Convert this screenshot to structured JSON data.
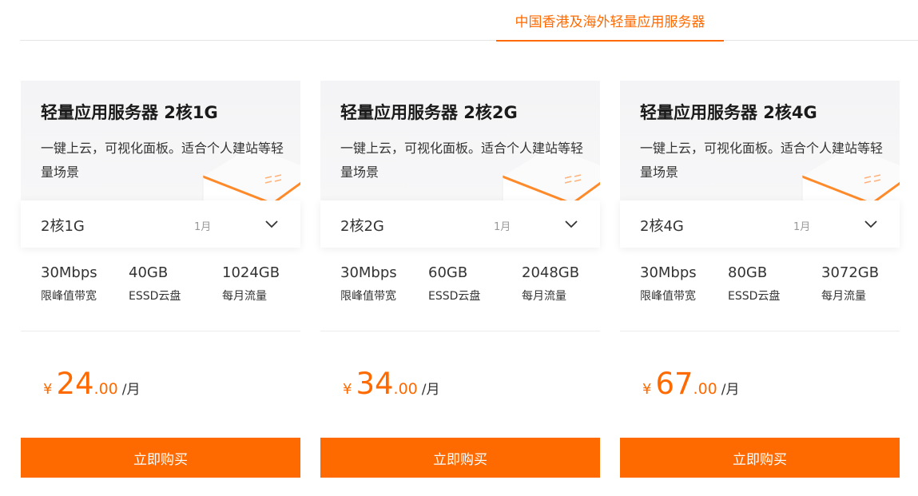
{
  "tabs": [
    {
      "label": "中国香港及海外轻量应用服务器",
      "active": true
    }
  ],
  "colors": {
    "accent": "#ff6a00",
    "text": "#333333",
    "muted": "#999999",
    "card_top": "#f4f4f6"
  },
  "icons": {
    "chevron": "chevron-down-icon"
  },
  "cards": [
    {
      "title": "轻量应用服务器 2核1G",
      "desc": "一键上云，可视化面板。适合个人建站等轻量场景",
      "selector": {
        "value": "2核1G",
        "period": "1月"
      },
      "specs": [
        {
          "value": "30Mbps",
          "label": "限峰值带宽"
        },
        {
          "value": "40GB",
          "label": "ESSD云盘"
        },
        {
          "value": "1024GB",
          "label": "每月流量"
        }
      ],
      "price": {
        "currency": "¥",
        "integer": "24",
        "decimal": ".00",
        "unit": "/月"
      },
      "buy_label": "立即购买"
    },
    {
      "title": "轻量应用服务器 2核2G",
      "desc": "一键上云，可视化面板。适合个人建站等轻量场景",
      "selector": {
        "value": "2核2G",
        "period": "1月"
      },
      "specs": [
        {
          "value": "30Mbps",
          "label": "限峰值带宽"
        },
        {
          "value": "60GB",
          "label": "ESSD云盘"
        },
        {
          "value": "2048GB",
          "label": "每月流量"
        }
      ],
      "price": {
        "currency": "¥",
        "integer": "34",
        "decimal": ".00",
        "unit": "/月"
      },
      "buy_label": "立即购买"
    },
    {
      "title": "轻量应用服务器 2核4G",
      "desc": "一键上云，可视化面板。适合个人建站等轻量场景",
      "selector": {
        "value": "2核4G",
        "period": "1月"
      },
      "specs": [
        {
          "value": "30Mbps",
          "label": "限峰值带宽"
        },
        {
          "value": "80GB",
          "label": "ESSD云盘"
        },
        {
          "value": "3072GB",
          "label": "每月流量"
        }
      ],
      "price": {
        "currency": "¥",
        "integer": "67",
        "decimal": ".00",
        "unit": "/月"
      },
      "buy_label": "立即购买"
    }
  ]
}
